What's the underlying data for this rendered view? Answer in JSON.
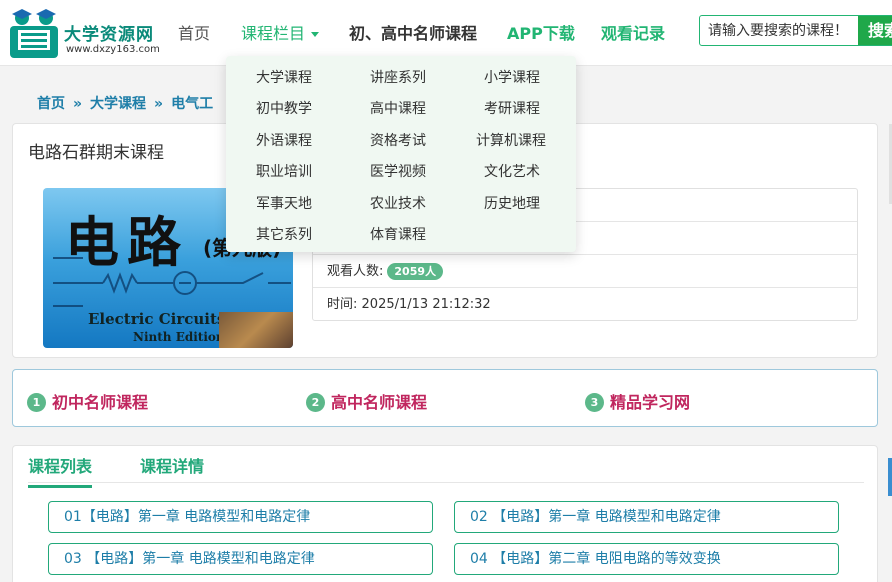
{
  "header": {
    "logo_title": "大学资源网",
    "logo_url": "www.dxzy163.com",
    "nav": {
      "home": "首页",
      "column": "课程栏目",
      "famous": "初、高中名师课程",
      "app": "APP下载",
      "history": "观看记录"
    },
    "search": {
      "placeholder": "请输入要搜索的课程！",
      "button": "搜索"
    }
  },
  "dropdown": {
    "items": [
      "大学课程",
      "讲座系列",
      "小学课程",
      "初中教学",
      "高中课程",
      "考研课程",
      "外语课程",
      "资格考试",
      "计算机课程",
      "职业培训",
      "医学视频",
      "文化艺术",
      "军事天地",
      "农业技术",
      "历史地理",
      "其它系列",
      "体育课程"
    ]
  },
  "breadcrumb": {
    "items": [
      "首页",
      "大学课程",
      "电气工"
    ],
    "separator": "»"
  },
  "course": {
    "title": "电路石群期末课程",
    "cover": {
      "big_text": "电路",
      "edition_cn": "(第九版)",
      "en_title": "Electric Circuits",
      "en_edition": "Ninth Edition"
    },
    "views_label": "观看人数:",
    "views": "2059人",
    "time_label": "时间:",
    "time": "2025/1/13 21:12:32"
  },
  "links": [
    {
      "num": "1",
      "label": "初中名师课程"
    },
    {
      "num": "2",
      "label": "高中名师课程"
    },
    {
      "num": "3",
      "label": "精品学习网"
    }
  ],
  "tabs": {
    "list": "课程列表",
    "detail": "课程详情"
  },
  "lessons": [
    "01【电路】第一章 电路模型和电路定律",
    "02 【电路】第一章 电路模型和电路定律",
    "03 【电路】第一章 电路模型和电路定律",
    "04 【电路】第二章 电阻电路的等效变换"
  ],
  "colors": {
    "brand_green": "#22b573",
    "link_blue": "#1e7ea8",
    "accent_red": "#c0265e",
    "badge_green": "#5cb88a"
  }
}
